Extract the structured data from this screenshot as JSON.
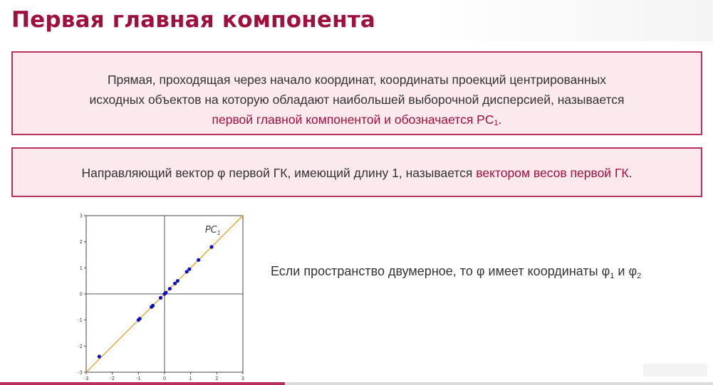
{
  "slide": {
    "title": "Первая главная компонента",
    "definition": {
      "line1": "Прямая, проходящая через начало координат, координаты проекций центрированных",
      "line2": "исходных объектов на которую обладают наибольшей выборочной дисперсией, называется",
      "highlight": "первой главной компонентой и обозначается PC",
      "highlight_sub": "1",
      "end": "."
    },
    "weights": {
      "text": "Направляющий вектор φ первой ГК, имеющий длину 1, называется ",
      "highlight": "вектором весов первой ГК",
      "end": "."
    },
    "right_text": {
      "prefix": "Если пространство двумерное, то φ имеет координаты  φ",
      "sub1": "1",
      "mid": " и φ",
      "sub2": "2"
    }
  },
  "colors": {
    "accent": "#a0103e",
    "box_bg": "#fbe9ee",
    "box_border": "#b8325b",
    "line": "#e0a020",
    "points": "#1010c0"
  },
  "chart_data": {
    "type": "scatter",
    "xlim": [
      -3,
      3
    ],
    "ylim": [
      -3,
      3
    ],
    "x_ticks": [
      "-3",
      "-2",
      "-1",
      "0",
      "1",
      "2",
      "3"
    ],
    "y_ticks": [
      "-3",
      "-2",
      "-1",
      "0",
      "1",
      "2",
      "3"
    ],
    "line_label": "PC",
    "line_label_sub": "1",
    "line": {
      "x": [
        -3,
        3
      ],
      "y": [
        -3,
        3
      ]
    },
    "points": [
      {
        "x": -2.5,
        "y": -2.4
      },
      {
        "x": -1.0,
        "y": -1.0
      },
      {
        "x": -0.95,
        "y": -0.95
      },
      {
        "x": -0.5,
        "y": -0.5
      },
      {
        "x": -0.45,
        "y": -0.45
      },
      {
        "x": -0.15,
        "y": -0.15
      },
      {
        "x": 0.0,
        "y": 0.0
      },
      {
        "x": 0.05,
        "y": 0.05
      },
      {
        "x": 0.2,
        "y": 0.2
      },
      {
        "x": 0.4,
        "y": 0.4
      },
      {
        "x": 0.5,
        "y": 0.5
      },
      {
        "x": 0.85,
        "y": 0.85
      },
      {
        "x": 0.95,
        "y": 0.95
      },
      {
        "x": 1.3,
        "y": 1.3
      },
      {
        "x": 1.8,
        "y": 1.8
      }
    ]
  }
}
